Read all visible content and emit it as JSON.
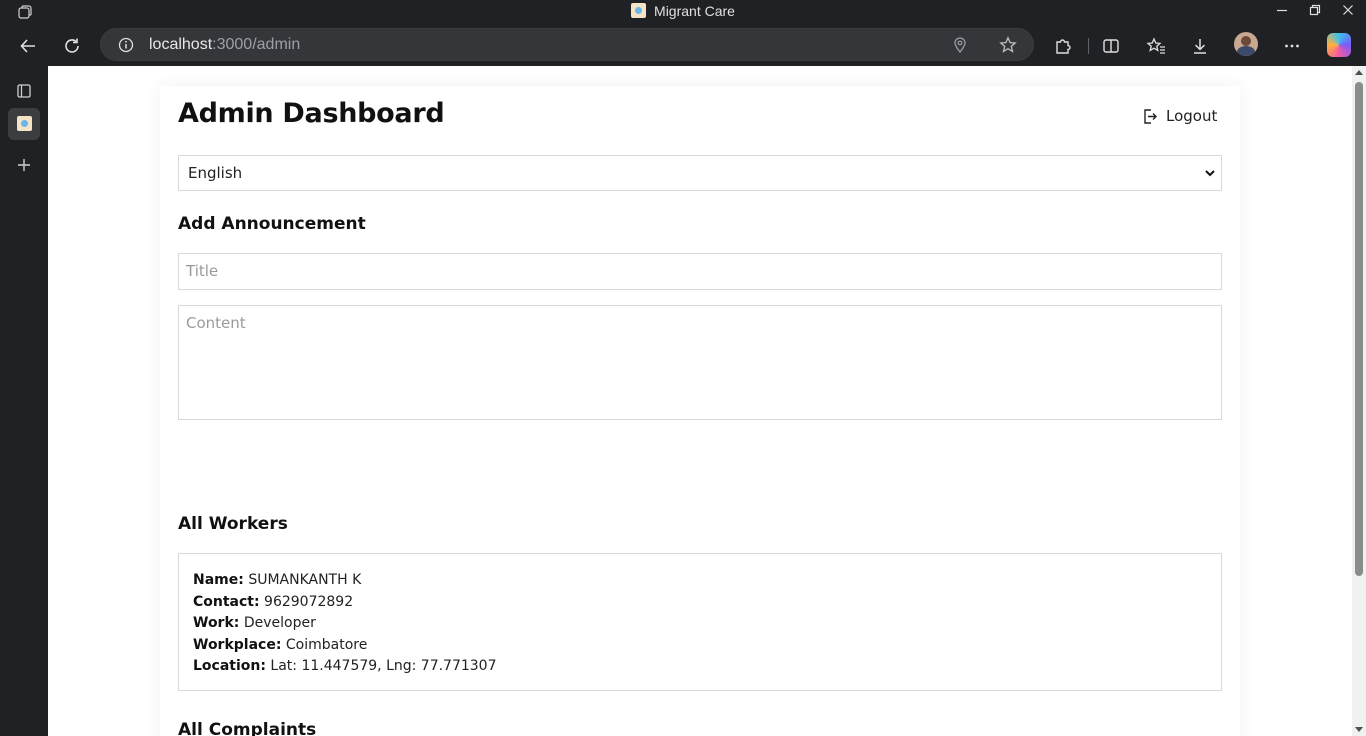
{
  "window": {
    "title": "Migrant Care"
  },
  "browser": {
    "url_host": "localhost",
    "url_path": ":3000/admin"
  },
  "page": {
    "title": "Admin Dashboard",
    "logout_label": "Logout",
    "language": {
      "selected": "English"
    },
    "announcement": {
      "heading": "Add Announcement",
      "title_placeholder": "Title",
      "content_placeholder": "Content"
    },
    "workers": {
      "heading": "All Workers",
      "items": [
        {
          "name_label": "Name:",
          "name": "SUMANKANTH K",
          "contact_label": "Contact:",
          "contact": "9629072892",
          "work_label": "Work:",
          "work": "Developer",
          "workplace_label": "Workplace:",
          "workplace": "Coimbatore",
          "location_label": "Location:",
          "location": "Lat: 11.447579, Lng: 77.771307"
        }
      ]
    },
    "complaints": {
      "heading": "All Complaints"
    }
  },
  "icons": {
    "tab_actions": "tab-actions-icon",
    "back": "back-arrow-icon",
    "refresh": "refresh-icon",
    "info": "site-info-icon",
    "location": "location-pin-icon",
    "favorite": "star-icon",
    "extensions": "puzzle-icon",
    "split": "split-screen-icon",
    "favorites": "favorites-icon",
    "downloads": "download-icon",
    "more": "more-icon",
    "logout": "logout-icon"
  }
}
